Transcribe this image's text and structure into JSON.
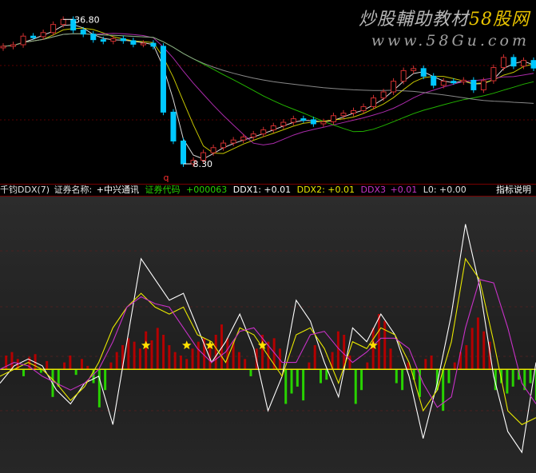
{
  "watermark": {
    "line1_prefix": "炒股輔助教材",
    "line1_accent": "58股网",
    "line2": "www.58Gu.com"
  },
  "price_annotations": {
    "high_label": "36.80",
    "low_label": "8.30",
    "marker": "q"
  },
  "infobar": {
    "title": "千钧DDX(7)",
    "name_label": "证券名称:",
    "name_value": "+中兴通讯",
    "code_label": "证券代码",
    "code_value": "+000063",
    "ddx1": "DDX1: +0.01",
    "ddx2": "DDX2: +0.01",
    "ddx3": "DDX3",
    "ddx3_value": "+0.01",
    "l0": "L0: +0.00",
    "help": "指标说明"
  },
  "colors": {
    "up": "#e8e8e8",
    "down": "#00c8ff",
    "ddx_pos": "#b40000",
    "ddx_neg": "#28d200",
    "zero_line": "#e8e800",
    "ddx1": "#ffffff",
    "ddx2": "#e8e800",
    "ddx3": "#c832c8",
    "star": "#ffe000"
  },
  "chart_data": [
    {
      "type": "line",
      "series": [
        {
          "values": [
            31.5,
            31.8,
            33.5,
            33.4,
            34.2,
            35.8,
            36.8,
            34.7,
            33.9,
            32.8,
            32.5,
            33.0,
            32.6,
            31.9,
            32.1,
            31.5,
            18.5,
            12.8,
            8.3,
            9.0,
            10.5,
            11.5,
            12.4,
            13.0,
            13.6,
            14.2,
            15.0,
            15.8,
            16.5,
            17.2,
            17.0,
            16.2,
            16.6,
            17.8,
            18.3,
            18.8,
            19.6,
            21.3,
            22.5,
            24.6,
            26.7,
            27.1,
            25.6,
            23.8,
            24.6,
            24.5,
            24.8,
            22.9,
            24.7,
            27.3,
            29.3,
            27.6,
            28.7,
            27.2
          ]
        }
      ],
      "ylim": [
        5,
        40
      ]
    },
    {
      "type": "bar",
      "series": [
        {
          "name": "DDX",
          "values": [
            0.2,
            0.25,
            0.15,
            -0.1,
            0.18,
            0.22,
            -0.05,
            0.12,
            -0.4,
            -0.25,
            0.1,
            0.2,
            -0.08,
            0.15,
            0.05,
            -0.2,
            -0.55,
            -0.3,
            0.1,
            0.25,
            0.35,
            0.45,
            0.4,
            0.3,
            0.55,
            0.42,
            0.6,
            0.5,
            0.35,
            0.25,
            0.2,
            0.15,
            0.3,
            0.4,
            0.45,
            0.35,
            0.5,
            0.65,
            0.45,
            0.4,
            0.25,
            0.15,
            -0.1,
            0.3,
            0.5,
            0.4,
            0.45,
            0.3,
            -0.5,
            -0.35,
            -0.25,
            -0.45,
            0.1,
            0.35,
            -0.2,
            -0.15,
            0.25,
            0.55,
            0.5,
            0.2,
            -0.5,
            -0.3,
            0.1,
            0.6,
            0.8,
            0.7,
            0.3,
            -0.2,
            -0.3,
            0.1,
            -0.15,
            -0.4,
            0.15,
            0.2,
            -0.3,
            -0.6,
            -0.2,
            0.1,
            0.25,
            0.35,
            0.6,
            0.75,
            0.55,
            0.4,
            -0.3,
            -0.2,
            -0.35,
            -0.25,
            -0.15,
            -0.3,
            -0.2,
            -0.45
          ]
        },
        {
          "name": "DDX1",
          "values": [
            -0.2,
            0.05,
            0.15,
            0.05,
            -0.3,
            -0.5,
            -0.2,
            -0.1,
            -0.8,
            0.4,
            1.6,
            1.3,
            1.0,
            1.1,
            0.6,
            0.1,
            0.4,
            0.8,
            0.3,
            -0.6,
            -0.1,
            1.0,
            0.7,
            0.1,
            -0.4,
            0.6,
            0.4,
            0.8,
            0.5,
            -0.1,
            -1.0,
            -0.2,
            0.8,
            2.1,
            1.2,
            -0.1,
            -0.9,
            -1.2,
            0.1
          ]
        },
        {
          "name": "DDX2",
          "values": [
            -0.1,
            0.0,
            0.1,
            0.0,
            -0.2,
            -0.45,
            -0.25,
            0.1,
            0.6,
            0.9,
            1.1,
            0.9,
            0.8,
            0.9,
            0.5,
            0.4,
            0.1,
            0.6,
            0.5,
            0.2,
            -0.1,
            0.5,
            0.6,
            0.3,
            -0.2,
            0.4,
            0.3,
            0.6,
            0.5,
            0.1,
            -0.6,
            -0.3,
            0.4,
            1.6,
            1.3,
            0.4,
            -0.6,
            -0.8,
            -0.7
          ]
        },
        {
          "name": "DDX3",
          "values": [
            0.0,
            0.1,
            0.05,
            -0.1,
            -0.2,
            -0.3,
            -0.2,
            0.0,
            0.4,
            0.9,
            1.05,
            0.95,
            0.9,
            0.6,
            0.3,
            0.1,
            0.25,
            0.55,
            0.6,
            0.35,
            0.1,
            0.1,
            0.5,
            0.55,
            0.3,
            0.1,
            0.25,
            0.45,
            0.45,
            0.3,
            -0.2,
            -0.55,
            -0.4,
            0.6,
            1.3,
            1.25,
            0.6,
            -0.2,
            -0.5
          ]
        }
      ],
      "ylim": [
        -1.5,
        2.5
      ]
    }
  ]
}
